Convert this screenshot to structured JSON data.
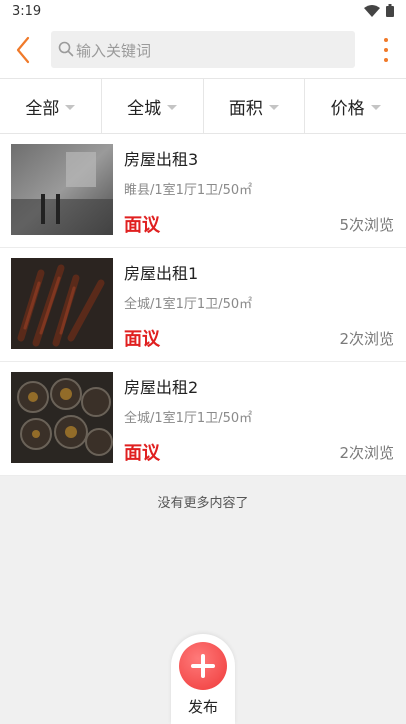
{
  "status_bar": {
    "time": "3:19"
  },
  "header": {
    "search_placeholder": "输入关键词"
  },
  "filters": [
    {
      "label": "全部"
    },
    {
      "label": "全城"
    },
    {
      "label": "面积"
    },
    {
      "label": "价格"
    }
  ],
  "listings": [
    {
      "title": "房屋出租3",
      "desc": "睢县/1室1厅1卫/50㎡",
      "price": "面议",
      "views": "5次浏览"
    },
    {
      "title": "房屋出租1",
      "desc": "全城/1室1厅1卫/50㎡",
      "price": "面议",
      "views": "2次浏览"
    },
    {
      "title": "房屋出租2",
      "desc": "全城/1室1厅1卫/50㎡",
      "price": "面议",
      "views": "2次浏览"
    }
  ],
  "footer": {
    "no_more": "没有更多内容了"
  },
  "fab": {
    "label": "发布"
  },
  "colors": {
    "accent": "#f07a2a",
    "price": "#e02020",
    "fab": "#ef3a3a"
  }
}
